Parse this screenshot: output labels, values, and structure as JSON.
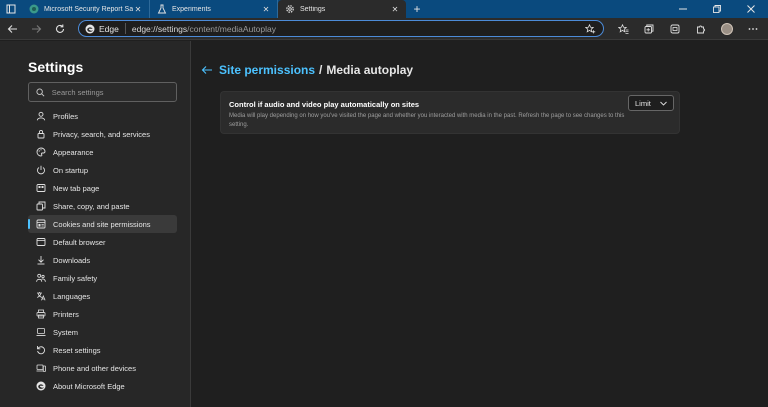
{
  "tabs": [
    {
      "label": "Microsoft Security Report Says F",
      "icon": "site-globe-icon",
      "active": false
    },
    {
      "label": "Experiments",
      "icon": "flask-icon",
      "active": false
    },
    {
      "label": "Settings",
      "icon": "gear-icon",
      "active": true
    }
  ],
  "tab_close_glyph": "✕",
  "new_tab_glyph": "+",
  "address": {
    "brand": "Edge",
    "url_host": "edge://settings",
    "url_path": "/content/mediaAutoplay"
  },
  "sidebar": {
    "title": "Settings",
    "search_placeholder": "Search settings",
    "items": [
      {
        "label": "Profiles",
        "icon": "profile-icon"
      },
      {
        "label": "Privacy, search, and services",
        "icon": "lock-icon"
      },
      {
        "label": "Appearance",
        "icon": "palette-icon"
      },
      {
        "label": "On startup",
        "icon": "power-icon"
      },
      {
        "label": "New tab page",
        "icon": "newtab-icon"
      },
      {
        "label": "Share, copy, and paste",
        "icon": "share-icon"
      },
      {
        "label": "Cookies and site permissions",
        "icon": "cookie-icon",
        "active": true
      },
      {
        "label": "Default browser",
        "icon": "browser-icon"
      },
      {
        "label": "Downloads",
        "icon": "download-icon"
      },
      {
        "label": "Family safety",
        "icon": "family-icon"
      },
      {
        "label": "Languages",
        "icon": "language-icon"
      },
      {
        "label": "Printers",
        "icon": "printer-icon"
      },
      {
        "label": "System",
        "icon": "system-icon"
      },
      {
        "label": "Reset settings",
        "icon": "reset-icon"
      },
      {
        "label": "Phone and other devices",
        "icon": "phone-icon"
      },
      {
        "label": "About Microsoft Edge",
        "icon": "edge-logo-icon"
      }
    ]
  },
  "main": {
    "breadcrumb_parent": "Site permissions",
    "breadcrumb_sep": "/",
    "breadcrumb_current": "Media autoplay",
    "card": {
      "title": "Control if audio and video play automatically on sites",
      "description": "Media will play depending on how you've visited the page and whether you interacted with media in the past. Refresh the page to see changes to this setting.",
      "select_value": "Limit"
    }
  },
  "colors": {
    "tabstrip": "#0a4a7e",
    "accent": "#4cc2ff",
    "background": "#1f1f1f",
    "sidebar": "#272727"
  }
}
